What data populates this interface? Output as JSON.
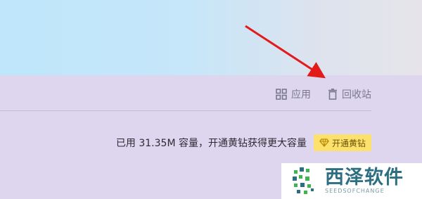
{
  "toolbar": {
    "apps_label": "应用",
    "recycle_label": "回收站"
  },
  "storage": {
    "capacity_text": "已用 31.35M 容量，开通黄钻获得更大容量",
    "vip_button_label": "开通黄钻"
  },
  "watermark": {
    "title": "西泽软件",
    "subtitle": "SEEDSOFCHANGE"
  },
  "colors": {
    "banner_left": "#bfe6fb",
    "content_bg": "#ded6ef",
    "arrow": "#e21a1a",
    "vip_button_bg": "#fce16c",
    "watermark_text": "#2d6f82",
    "watermark_green": "#3fb54f"
  },
  "icons": {
    "apps": "grid-icon",
    "recycle": "trash-icon",
    "vip": "diamond-icon",
    "annotation": "red-arrow-icon"
  }
}
